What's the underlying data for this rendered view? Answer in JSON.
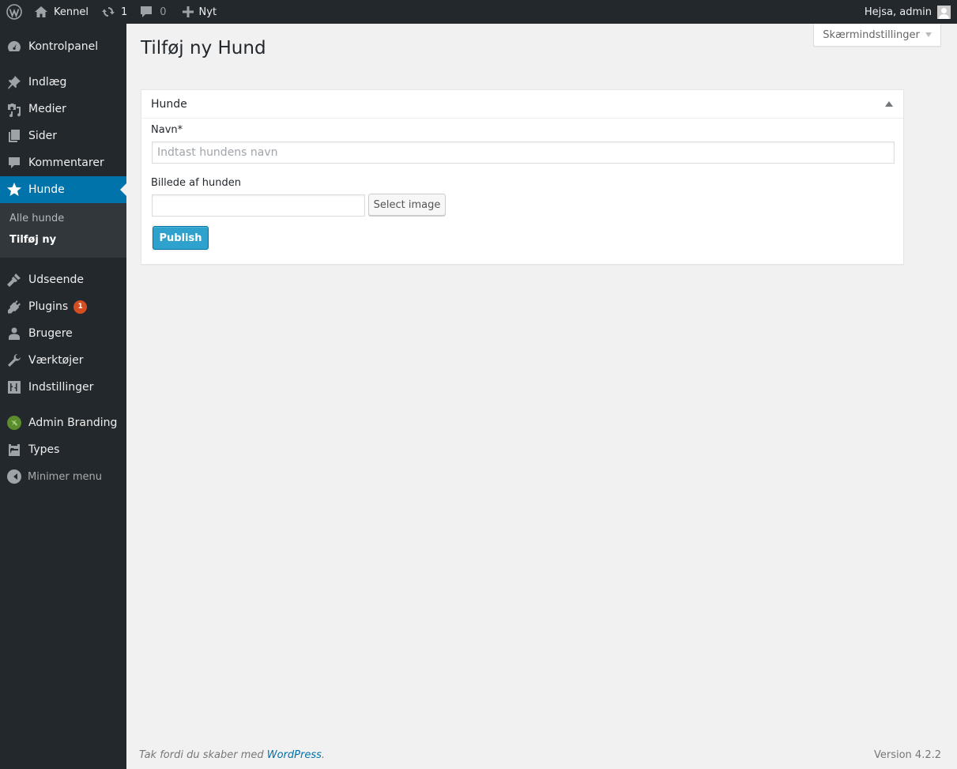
{
  "adminbar": {
    "site_name": "Kennel",
    "updates_count": "1",
    "comments_count": "0",
    "new_label": "Nyt",
    "greeting": "Hejsa, admin",
    "icons": [
      "wordpress-logo-icon",
      "home-icon",
      "updates-icon",
      "comment-icon",
      "plus-icon",
      "avatar-icon"
    ]
  },
  "sidebar": {
    "items": [
      {
        "label": "Kontrolpanel",
        "icon": "dashboard-icon"
      },
      {
        "label": "Indlæg",
        "icon": "pin-icon"
      },
      {
        "label": "Medier",
        "icon": "media-icon"
      },
      {
        "label": "Sider",
        "icon": "pages-icon"
      },
      {
        "label": "Kommentarer",
        "icon": "comments-icon"
      },
      {
        "label": "Hunde",
        "icon": "star-icon",
        "current": true
      },
      {
        "label": "Udseende",
        "icon": "brush-icon"
      },
      {
        "label": "Plugins",
        "icon": "plugin-icon",
        "badge": "1"
      },
      {
        "label": "Brugere",
        "icon": "user-icon"
      },
      {
        "label": "Værktøjer",
        "icon": "wrench-icon"
      },
      {
        "label": "Indstillinger",
        "icon": "settings-icon"
      },
      {
        "label": "Admin Branding",
        "icon": "admin-branding-icon"
      },
      {
        "label": "Types",
        "icon": "folder-icon"
      }
    ],
    "submenu": [
      {
        "label": "Alle hunde"
      },
      {
        "label": "Tilføj ny",
        "current": true
      }
    ],
    "collapse_label": "Minimer menu"
  },
  "screen_options": {
    "label": "Skærmindstillinger"
  },
  "page": {
    "title": "Tilføj ny Hund"
  },
  "postbox": {
    "title": "Hunde",
    "name_label": "Navn*",
    "name_value": "",
    "name_placeholder": "Indtast hundens navn",
    "image_label": "Billede af hunden",
    "image_value": "",
    "select_image_label": "Select image",
    "publish_label": "Publish"
  },
  "footer": {
    "thanks_prefix": "Tak fordi du skaber med ",
    "thanks_link": "WordPress",
    "thanks_suffix": ".",
    "version": "Version 4.2.2"
  },
  "colors": {
    "adminbar_bg": "#23282d",
    "menu_current": "#0073aa",
    "submenu_bg": "#32373c",
    "badge": "#d54e21",
    "primary_button": "#2ea2cc",
    "link": "#0073aa"
  }
}
